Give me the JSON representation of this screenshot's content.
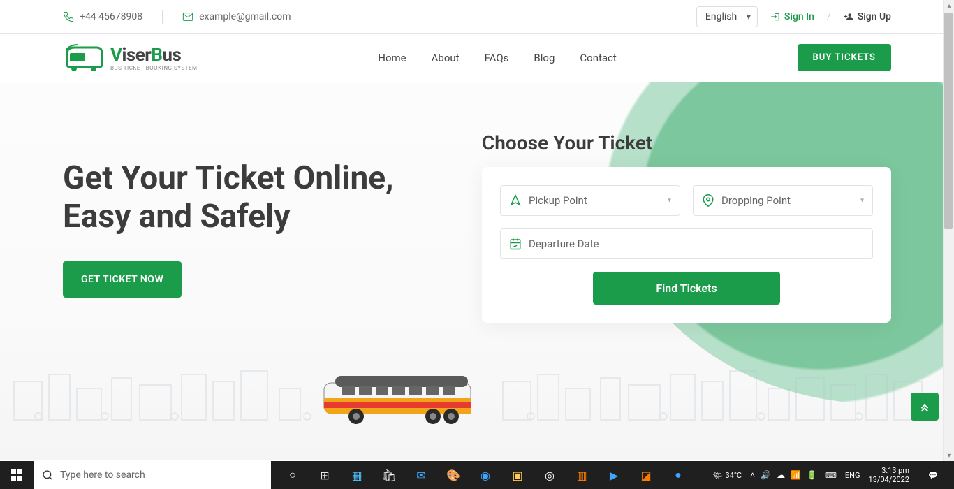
{
  "topbar": {
    "phone": "+44 45678908",
    "email": "example@gmail.com",
    "language": "English",
    "signin": "Sign In",
    "signup": "Sign Up"
  },
  "nav": {
    "brand": "ViserBus",
    "tagline": "BUS TICKET BOOKING SYSTEM",
    "links": [
      "Home",
      "About",
      "FAQs",
      "Blog",
      "Contact"
    ],
    "buy": "BUY  TICKETS"
  },
  "hero": {
    "headline": "Get Your Ticket Online, Easy and Safely",
    "cta": "GET TICKET NOW",
    "form_title": "Choose Your Ticket",
    "pickup_placeholder": "Pickup Point",
    "dropping_placeholder": "Dropping Point",
    "date_placeholder": "Departure Date",
    "find": "Find Tickets"
  },
  "taskbar": {
    "search_placeholder": "Type here to search",
    "temp": "34°C",
    "lang": "ENG",
    "time": "3:13 pm",
    "date": "13/04/2022"
  }
}
